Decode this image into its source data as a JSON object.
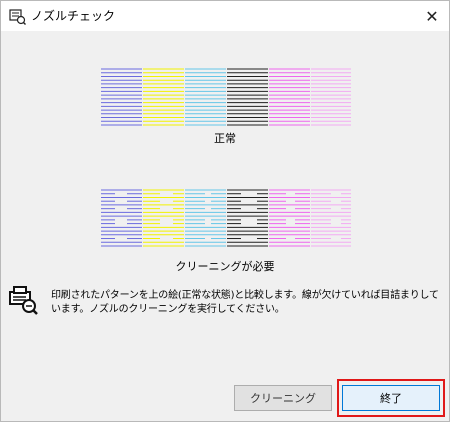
{
  "window": {
    "title": "ノズルチェック",
    "close_glyph": "✕"
  },
  "patterns": {
    "normal_caption": "正常",
    "cleaning_caption": "クリーニングが必要",
    "colors": [
      "#6a6ae0",
      "#f2f200",
      "#64c6e8",
      "#202020",
      "#ee66ee",
      "#f2aaf2"
    ]
  },
  "info": {
    "icon": "printer-nozzle-check-icon",
    "text": "印刷されたパターンを上の絵(正常な状態)と比較します。線が欠けていれば目詰まりしています。ノズルのクリーニングを実行してください。"
  },
  "buttons": {
    "cleaning_label": "クリーニング",
    "finish_label": "終了"
  }
}
